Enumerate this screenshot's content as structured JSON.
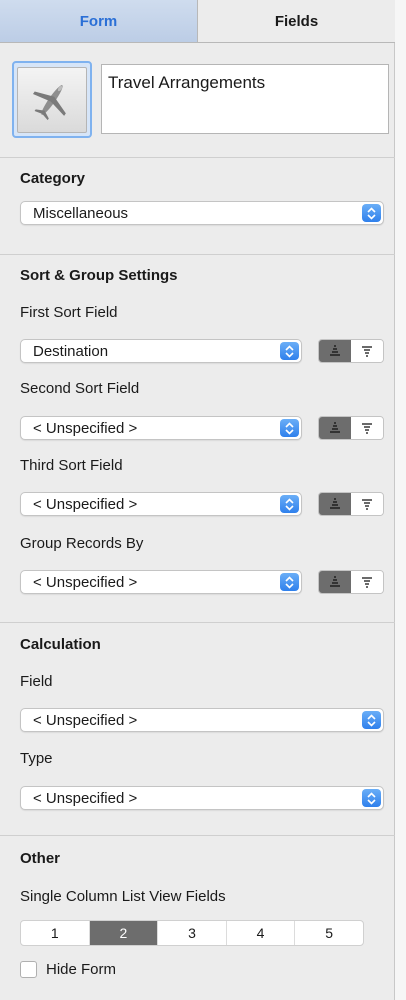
{
  "tabs": [
    {
      "label": "Form",
      "active": true
    },
    {
      "label": "Fields",
      "active": false
    }
  ],
  "form": {
    "icon": "airplane-icon",
    "name": "Travel Arrangements"
  },
  "category": {
    "heading": "Category",
    "value": "Miscellaneous"
  },
  "sort_group": {
    "heading": "Sort & Group Settings",
    "first": {
      "label": "First Sort Field",
      "value": "Destination"
    },
    "second": {
      "label": "Second Sort Field",
      "value": "< Unspecified >"
    },
    "third": {
      "label": "Third Sort Field",
      "value": "< Unspecified >"
    },
    "group": {
      "label": "Group Records By",
      "value": "< Unspecified >"
    }
  },
  "calculation": {
    "heading": "Calculation",
    "field_label": "Field",
    "field_value": "< Unspecified >",
    "type_label": "Type",
    "type_value": "< Unspecified >"
  },
  "other": {
    "heading": "Other",
    "columns_label": "Single Column List View Fields",
    "column_options": [
      "1",
      "2",
      "3",
      "4",
      "5"
    ],
    "selected_column": "2",
    "hide_form_label": "Hide Form",
    "hide_form_checked": false
  },
  "colors": {
    "accent": "#2f80ec",
    "tab_active_text": "#2a6fd6",
    "selected_segment": "#6d6d6d"
  }
}
